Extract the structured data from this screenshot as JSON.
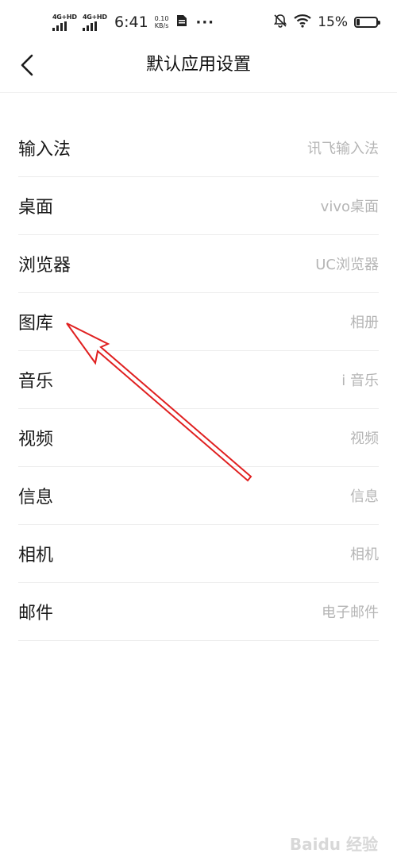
{
  "status_bar": {
    "signal_1": "4G+HD",
    "signal_2": "4G+HD",
    "time": "6:41",
    "net_speed_value": "0.10",
    "net_speed_unit": "KB/s",
    "more": "···",
    "battery_percent": "15%",
    "battery_level": 0.15
  },
  "header": {
    "title": "默认应用设置"
  },
  "settings": [
    {
      "label": "输入法",
      "value": "讯飞输入法"
    },
    {
      "label": "桌面",
      "value": "vivo桌面"
    },
    {
      "label": "浏览器",
      "value": "UC浏览器"
    },
    {
      "label": "图库",
      "value": "相册"
    },
    {
      "label": "音乐",
      "value": "i 音乐"
    },
    {
      "label": "视频",
      "value": "视频"
    },
    {
      "label": "信息",
      "value": "信息"
    },
    {
      "label": "相机",
      "value": "相机"
    },
    {
      "label": "邮件",
      "value": "电子邮件"
    }
  ],
  "watermark": "Baidu 经验",
  "colors": {
    "annotation_arrow": "#e02020",
    "secondary_text": "#b5b5b5",
    "divider": "#ececec"
  },
  "icons": {
    "back": "chevron-left-icon",
    "mute": "bell-off-icon",
    "wifi": "wifi-icon",
    "battery": "battery-icon",
    "sim_card": "sim-card-icon"
  }
}
